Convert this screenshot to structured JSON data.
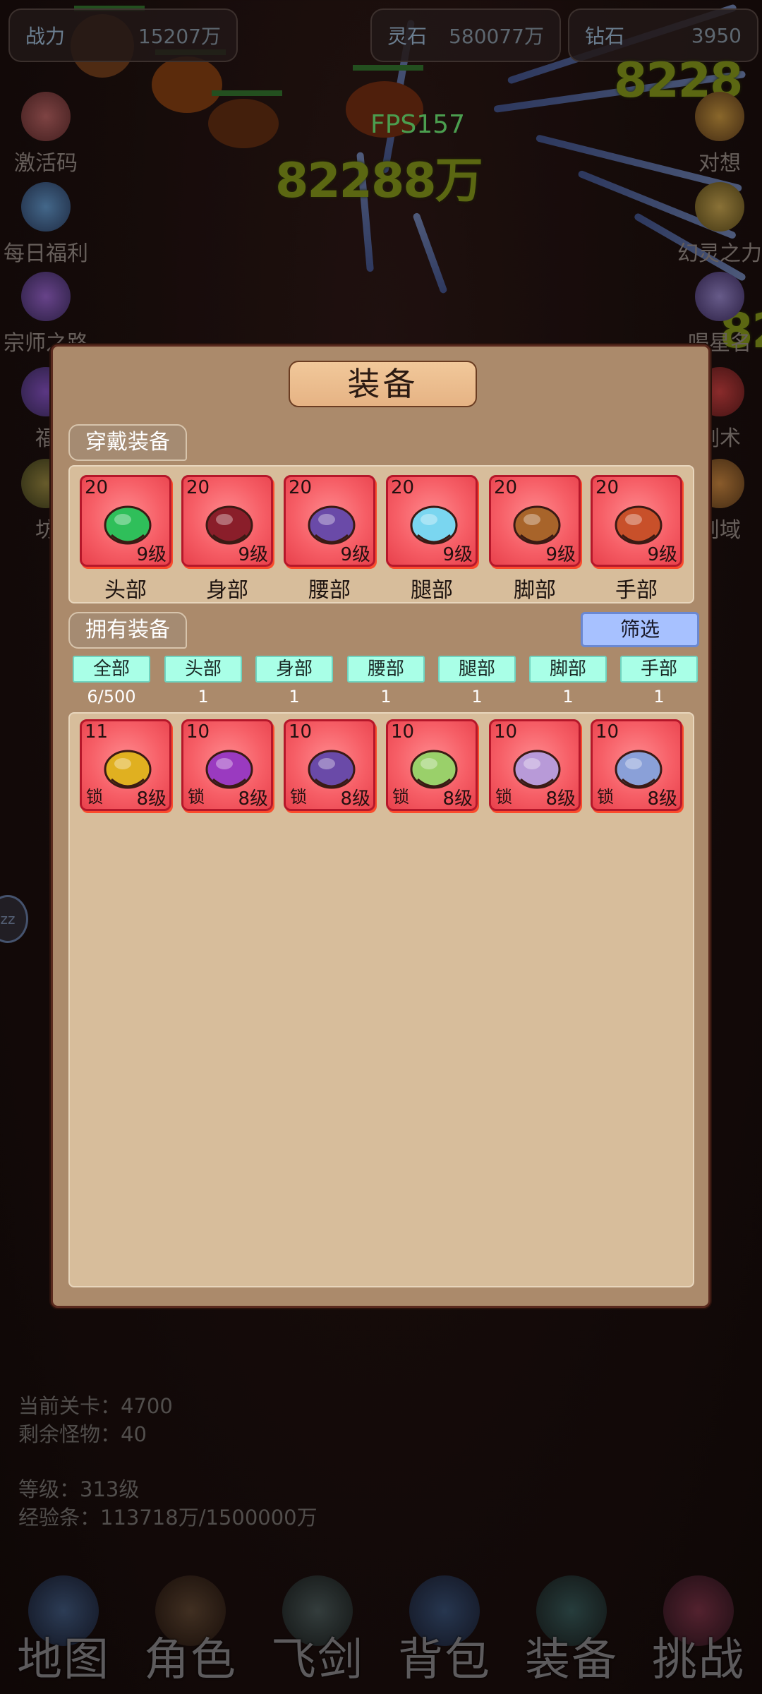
{
  "top_bar": {
    "power": {
      "label": "战力",
      "value": "15207万"
    },
    "spirit_stone": {
      "label": "灵石",
      "value": "580077万"
    },
    "diamond": {
      "label": "钻石",
      "value": "3950"
    }
  },
  "fps": "FPS157",
  "damage_numbers": [
    "82288万",
    "8228",
    "82"
  ],
  "left_side_icons": [
    "激活码",
    "每日福利",
    "宗师之路",
    "福",
    "坊"
  ],
  "right_side_icons": [
    "对想",
    "幻灵之力",
    "喝星名",
    "剑术",
    "则域"
  ],
  "left_bubble": "zz",
  "stage_info": {
    "current_stage": "当前关卡：4700",
    "remaining_monsters": "剩余怪物：40",
    "level": "等级：313级",
    "exp": "经验条：113718万/1500000万"
  },
  "bottom_nav": [
    "地图",
    "角色",
    "飞剑",
    "背包",
    "装备",
    "挑战"
  ],
  "modal": {
    "title": "装备",
    "worn_section": "穿戴装备",
    "owned_section": "拥有装备",
    "filter_button": "筛选",
    "worn": [
      {
        "tl": "20",
        "br": "9级",
        "label": "头部",
        "icon": "green-feather-helmet-icon",
        "color": "#2fbf5a"
      },
      {
        "tl": "20",
        "br": "9级",
        "label": "身部",
        "icon": "dragon-armor-icon",
        "color": "#8a1e2a"
      },
      {
        "tl": "20",
        "br": "9级",
        "label": "腰部",
        "icon": "purple-belt-icon",
        "color": "#6a4aa8"
      },
      {
        "tl": "20",
        "br": "9级",
        "label": "腿部",
        "icon": "blue-skirt-icon",
        "color": "#7ad6f0"
      },
      {
        "tl": "20",
        "br": "9级",
        "label": "脚部",
        "icon": "bronze-boots-icon",
        "color": "#a8642a"
      },
      {
        "tl": "20",
        "br": "9级",
        "label": "手部",
        "icon": "red-gauntlet-icon",
        "color": "#c8502a"
      }
    ],
    "categories": [
      {
        "label": "全部",
        "count": "6/500"
      },
      {
        "label": "头部",
        "count": "1"
      },
      {
        "label": "身部",
        "count": "1"
      },
      {
        "label": "腰部",
        "count": "1"
      },
      {
        "label": "腿部",
        "count": "1"
      },
      {
        "label": "脚部",
        "count": "1"
      },
      {
        "label": "手部",
        "count": "1"
      }
    ],
    "owned": [
      {
        "tl": "11",
        "lock": "锁",
        "br": "8级",
        "icon": "gold-armor-icon",
        "color": "#e0b020"
      },
      {
        "tl": "10",
        "lock": "锁",
        "br": "8级",
        "icon": "purple-gauntlet-icon",
        "color": "#9a3ac0"
      },
      {
        "tl": "10",
        "lock": "锁",
        "br": "8级",
        "icon": "purple-belt-icon",
        "color": "#6a4aa8"
      },
      {
        "tl": "10",
        "lock": "锁",
        "br": "8级",
        "icon": "green-skirt-icon",
        "color": "#9ad06a"
      },
      {
        "tl": "10",
        "lock": "锁",
        "br": "8级",
        "icon": "lavender-boots-icon",
        "color": "#b89ad8"
      },
      {
        "tl": "10",
        "lock": "锁",
        "br": "8级",
        "icon": "winged-helmet-icon",
        "color": "#8aa0d8"
      }
    ]
  }
}
